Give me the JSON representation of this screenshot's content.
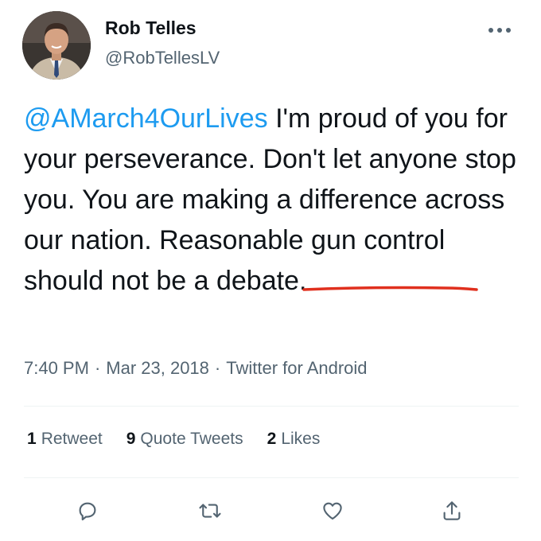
{
  "author": {
    "name": "Rob Telles",
    "handle": "@RobTellesLV"
  },
  "tweet": {
    "mention": "@AMarch4OurLives",
    "text_before_highlight": " I'm proud of you for your perseverance. Don't let anyone stop you. You are making a difference across our nation. Reasonable ",
    "highlighted_text": "gun control",
    "text_after_highlight": " should not be a debate."
  },
  "meta": {
    "time": "7:40 PM",
    "separator": "·",
    "date": "Mar 23, 2018",
    "source": "Twitter for Android"
  },
  "stats": [
    {
      "count": "1",
      "label": "Retweet"
    },
    {
      "count": "9",
      "label": "Quote Tweets"
    },
    {
      "count": "2",
      "label": "Likes"
    }
  ],
  "actions": [
    {
      "icon": "reply-icon"
    },
    {
      "icon": "retweet-icon"
    },
    {
      "icon": "like-icon"
    },
    {
      "icon": "share-icon"
    }
  ],
  "colors": {
    "mention": "#1d9bf0",
    "secondary_text": "#536471",
    "primary_text": "#0f1419",
    "annotation_underline": "#e0301e"
  }
}
